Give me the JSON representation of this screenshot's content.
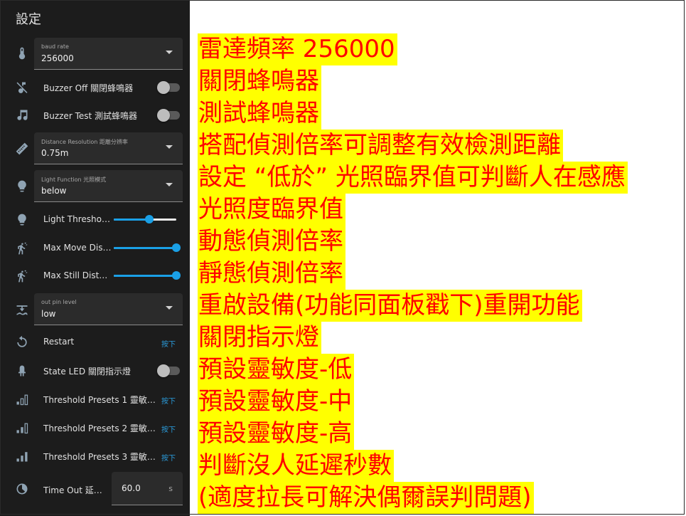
{
  "panel": {
    "title": "設定",
    "baud": {
      "caption": "baud rate",
      "value": "256000",
      "icon": "thermometer-icon"
    },
    "buzzer_off": {
      "label": "Buzzer Off 關閉蜂鳴器",
      "on": false,
      "icon": "music-off-icon"
    },
    "buzzer_test": {
      "label": "Buzzer Test 測試蜂鳴器",
      "on": false,
      "icon": "music-note-icon"
    },
    "distance_resolution": {
      "caption": "Distance Resolution 距離分辨率",
      "value": "0.75m",
      "icon": "ruler-icon"
    },
    "light_function": {
      "caption": "Light Function 光照模式",
      "value": "below",
      "icon": "lightbulb-icon"
    },
    "light_threshold": {
      "label": "Light Thresho…",
      "level": 0.57,
      "icon": "lightbulb-icon"
    },
    "max_move": {
      "label": "Max Move Dis…",
      "level": 1.0,
      "icon": "walk-motion-icon"
    },
    "max_still": {
      "label": "Max Still Dist…",
      "level": 1.0,
      "icon": "walk-motion-icon"
    },
    "out_pin": {
      "caption": "out pin level",
      "value": "low",
      "icon": "pin-level-icon"
    },
    "restart": {
      "label": "Restart",
      "action": "按下",
      "icon": "restart-icon"
    },
    "state_led": {
      "label": "State LED 關閉指示燈",
      "on": false,
      "icon": "led-icon"
    },
    "presets1": {
      "label": "Threshold Presets 1 靈敏…",
      "action": "按下",
      "icon": "signal-bars-low-icon"
    },
    "presets2": {
      "label": "Threshold Presets 2 靈敏…",
      "action": "按下",
      "icon": "signal-bars-mid-icon"
    },
    "presets3": {
      "label": "Threshold Presets 3 靈敏…",
      "action": "按下",
      "icon": "signal-bars-high-icon"
    },
    "timeout": {
      "label": "Time Out 延…",
      "value": "60.0",
      "unit": "s",
      "icon": "timer-icon"
    }
  },
  "notes": [
    "雷達頻率 256000",
    "關閉蜂鳴器",
    "測試蜂鳴器",
    "搭配偵測倍率可調整有效檢測距離",
    "設定 “低於” 光照臨界值可判斷人在感應",
    "光照度臨界值",
    "動態偵測倍率",
    "靜態偵測倍率",
    "重啟設備(功能同面板戳下)重開功能",
    "關閉指示燈",
    "預設靈敏度-低",
    "預設靈敏度-中",
    "預設靈敏度-高",
    "判斷沒人延遲秒數",
    "(適度拉長可解決偶爾誤判問題)"
  ],
  "colors": {
    "accent": "#1aa0e6",
    "panel_bg": "#1c1c1c",
    "note_bg": "#ffff00",
    "note_text": "#ff0000"
  }
}
